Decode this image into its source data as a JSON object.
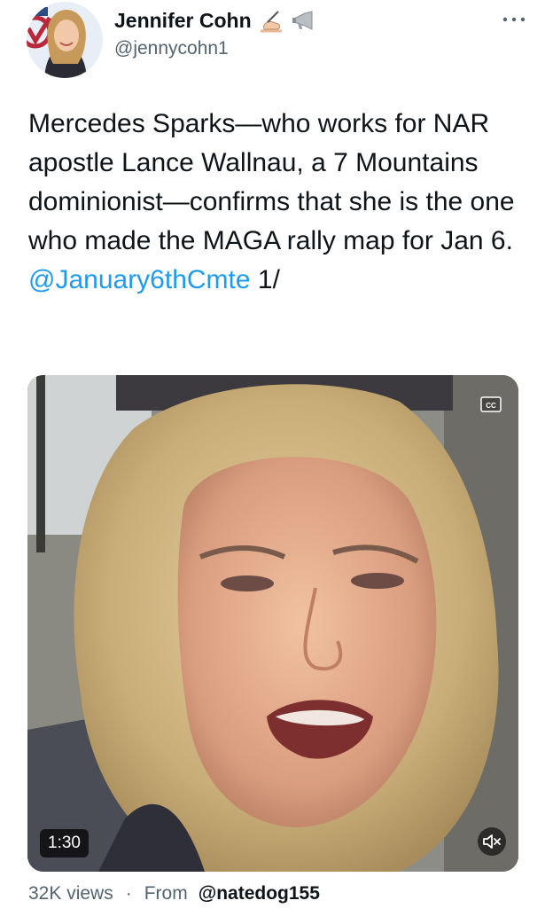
{
  "author": {
    "name": "Jennifer Cohn",
    "emojis": [
      "writing-hand-emoji",
      "megaphone-emoji"
    ],
    "handle": "@jennycohn1"
  },
  "tweet": {
    "text": "Mercedes Sparks—who works for NAR apostle Lance Wallnau, a 7 Mountains dominionist—confirms that she is the one who made the MAGA rally map for Jan 6.",
    "mention": "@January6thCmte",
    "suffix": " 1/"
  },
  "video": {
    "duration": "1:30",
    "cc_icon": "closed-captions-icon",
    "mute_icon": "speaker-muted-icon"
  },
  "meta": {
    "views": "32K views",
    "separator": "·",
    "from_label": "From",
    "source_handle": "@natedog155"
  },
  "colors": {
    "text": "#0f1419",
    "secondary": "#536471",
    "link": "#1d9bf0"
  }
}
